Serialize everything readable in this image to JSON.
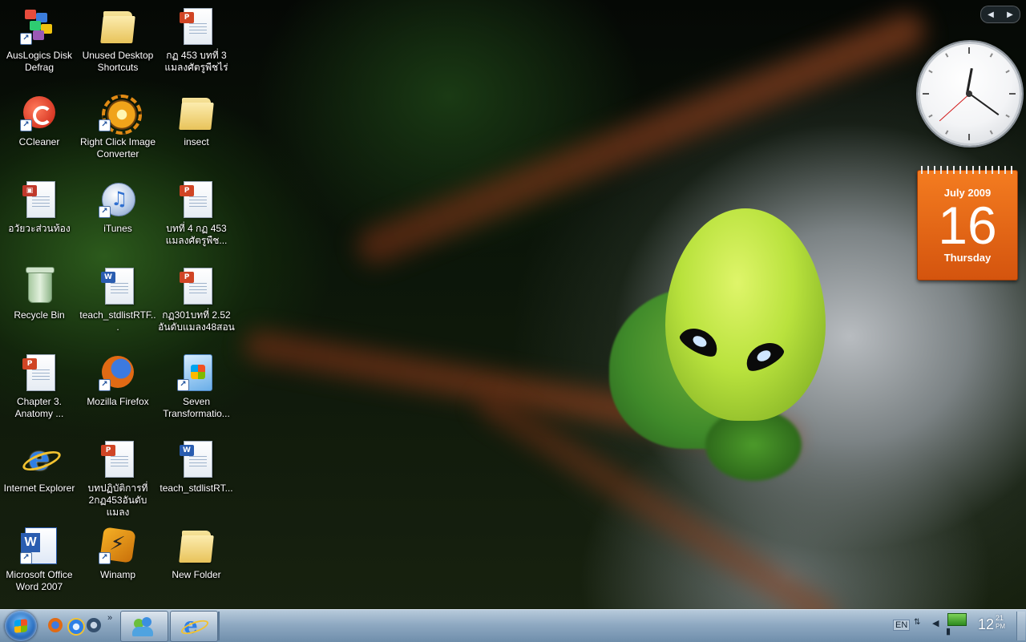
{
  "desktop": {
    "icons": [
      {
        "label": "AusLogics Disk\nDefrag",
        "icon": "disk-defrag-icon",
        "shortcut": true
      },
      {
        "label": "Unused Desktop\nShortcuts",
        "icon": "folder-icon",
        "shortcut": false
      },
      {
        "label": "กฏ 453 บทที่ 3\nแมลงศัตรูพืชไร่",
        "icon": "powerpoint-doc-icon",
        "shortcut": false
      },
      {
        "label": "CCleaner",
        "icon": "ccleaner-icon",
        "shortcut": true
      },
      {
        "label": "Right Click Image\nConverter",
        "icon": "gear-icon",
        "shortcut": true
      },
      {
        "label": "insect",
        "icon": "folder-icon",
        "shortcut": false
      },
      {
        "label": "อวัยวะส่วนท้อง",
        "icon": "pdf-doc-icon",
        "shortcut": false
      },
      {
        "label": "iTunes",
        "icon": "itunes-icon",
        "shortcut": true
      },
      {
        "label": "บทที่  4 กฏ 453\nแมลงศัตรูพืช...",
        "icon": "powerpoint-doc-icon",
        "shortcut": false
      },
      {
        "label": "Recycle Bin",
        "icon": "recycle-bin-icon",
        "shortcut": false
      },
      {
        "label": "teach_stdlistRTF...",
        "icon": "word-doc-icon",
        "shortcut": false
      },
      {
        "label": "กฏ301บทที่ 2.52\nอันดับแมลง48สอน",
        "icon": "powerpoint-doc-icon",
        "shortcut": false
      },
      {
        "label": "Chapter 3.\nAnatomy ...",
        "icon": "powerpoint-doc-icon",
        "shortcut": false
      },
      {
        "label": "Mozilla Firefox",
        "icon": "firefox-icon",
        "shortcut": true
      },
      {
        "label": "Seven\nTransformatio...",
        "icon": "seven-transformation-icon",
        "shortcut": true
      },
      {
        "label": "Internet Explorer",
        "icon": "internet-explorer-icon",
        "shortcut": false
      },
      {
        "label": "บทปฏิบัติการที่\n2กฏ453อันดับแมลง",
        "icon": "powerpoint-doc-icon",
        "shortcut": false
      },
      {
        "label": "teach_stdlistRT...",
        "icon": "word-doc-icon",
        "shortcut": false
      },
      {
        "label": "Microsoft Office\nWord 2007",
        "icon": "word-2007-icon",
        "shortcut": true
      },
      {
        "label": "Winamp",
        "icon": "winamp-icon",
        "shortcut": true
      },
      {
        "label": "New Folder",
        "icon": "folder-icon",
        "shortcut": false
      }
    ]
  },
  "gadgets": {
    "nav_prev": "◀",
    "nav_next": "▶",
    "clock": {
      "hour": 12,
      "minute": 21,
      "second": 38
    },
    "calendar": {
      "month": "July 2009",
      "day": "16",
      "weekday": "Thursday"
    }
  },
  "taskbar": {
    "start_icon": "windows-start-icon",
    "quick_launch_more": "»",
    "tray": {
      "language": "EN",
      "time_hour": "12",
      "time_minute": "21",
      "time_ampm": "PM"
    }
  },
  "colors": {
    "calendar": "#e8651a",
    "taskbar": "#8fa9c2"
  }
}
